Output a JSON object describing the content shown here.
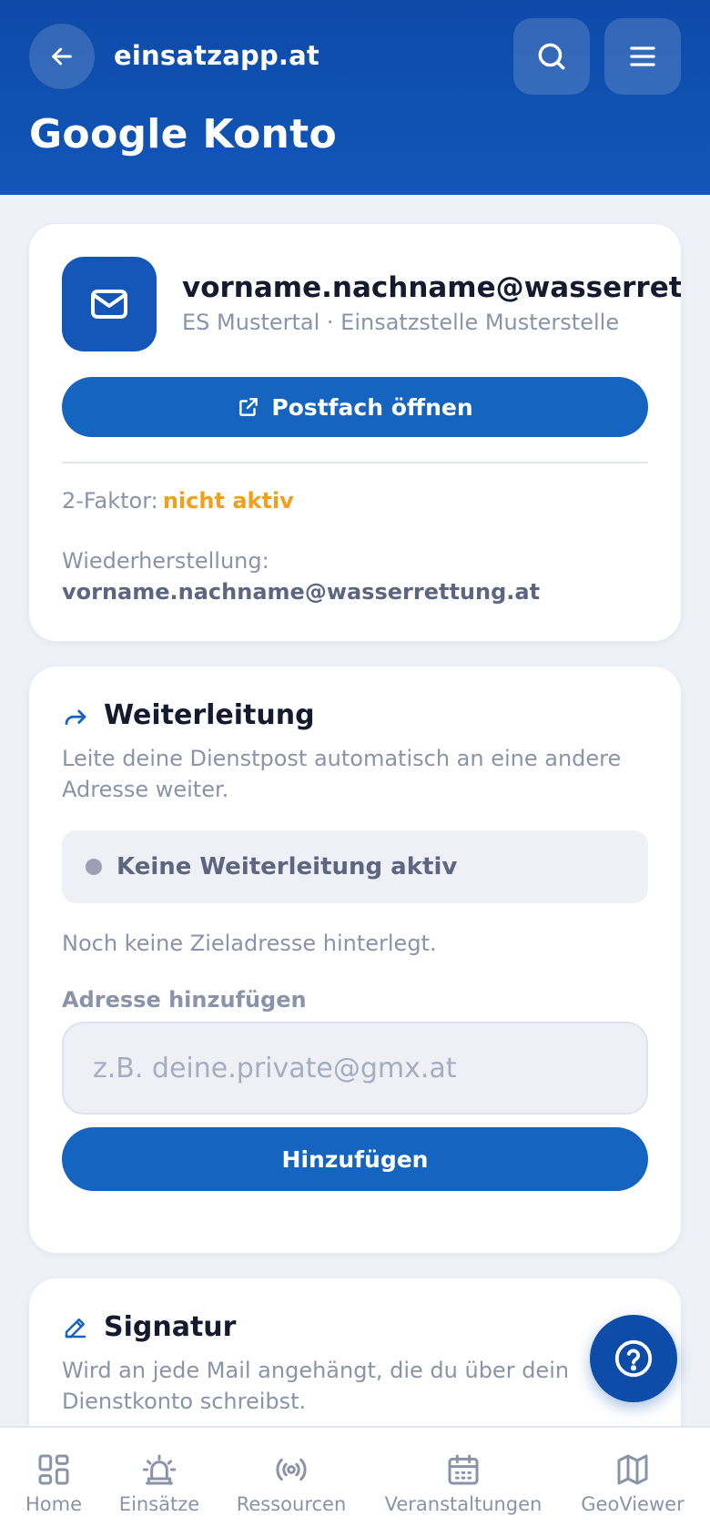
{
  "header": {
    "site_name": "einsatzapp.at",
    "page_title": "Google Konto",
    "icons": {
      "back": "arrow-left-icon",
      "search": "search-icon",
      "menu": "menu-icon"
    }
  },
  "account": {
    "email": "vorname.nachname@wasserrettung.at",
    "unit": "ES Mustertal · Einsatzstelle Musterstelle",
    "open_mailbox_label": "Postfach öffnen",
    "two_factor_label": "2-Faktor:",
    "two_factor_status": "nicht aktiv",
    "recovery_label": "Wiederherstellung:",
    "recovery_email": "vorname.nachname@wasserrettung.at"
  },
  "forwarding": {
    "title": "Weiterleitung",
    "description": "Leite deine Dienstpost automatisch an eine andere Adresse weiter.",
    "status": "Keine Weiterleitung aktiv",
    "no_target_text": "Noch keine Zieladresse hinterlegt.",
    "add_address_label": "Adresse hinzufügen",
    "input_placeholder": "z.B. deine.private@gmx.at",
    "input_value": "",
    "add_button_label": "Hinzufügen"
  },
  "signature": {
    "title": "Signatur",
    "description": "Wird an jede Mail angehängt, die du über dein Dienstkonto schreibst."
  },
  "bottom_nav": {
    "items": [
      {
        "label": "Home",
        "icon": "grid-icon"
      },
      {
        "label": "Einsätze",
        "icon": "siren-icon"
      },
      {
        "label": "Ressourcen",
        "icon": "broadcast-icon"
      },
      {
        "label": "Veranstaltungen",
        "icon": "calendar-icon"
      },
      {
        "label": "GeoViewer",
        "icon": "map-icon"
      }
    ]
  },
  "colors": {
    "brand": "#1565c0",
    "header": "#0d4aa8",
    "warning": "#f0a019",
    "muted_text": "#8b93a8"
  }
}
